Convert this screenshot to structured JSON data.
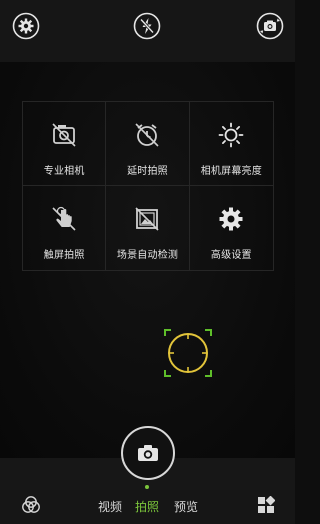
{
  "top_bar": {
    "settings_icon": "gear-icon",
    "flash_icon": "flash-off-icon",
    "switch_icon": "camera-switch-icon"
  },
  "menu": {
    "items": [
      {
        "label": "专业相机",
        "icon": "pro-camera-icon"
      },
      {
        "label": "延时拍照",
        "icon": "timer-icon"
      },
      {
        "label": "相机屏幕亮度",
        "icon": "brightness-icon"
      },
      {
        "label": "触屏拍照",
        "icon": "touch-shoot-icon"
      },
      {
        "label": "场景自动检测",
        "icon": "scene-detect-icon"
      },
      {
        "label": "高级设置",
        "icon": "gear-icon"
      }
    ]
  },
  "bottom": {
    "modes": [
      "视频",
      "拍照",
      "预览"
    ],
    "active_mode": "拍照",
    "accent_color": "#7cc53c",
    "left_icon": "filters-icon",
    "right_icon": "gallery-grid-icon"
  }
}
